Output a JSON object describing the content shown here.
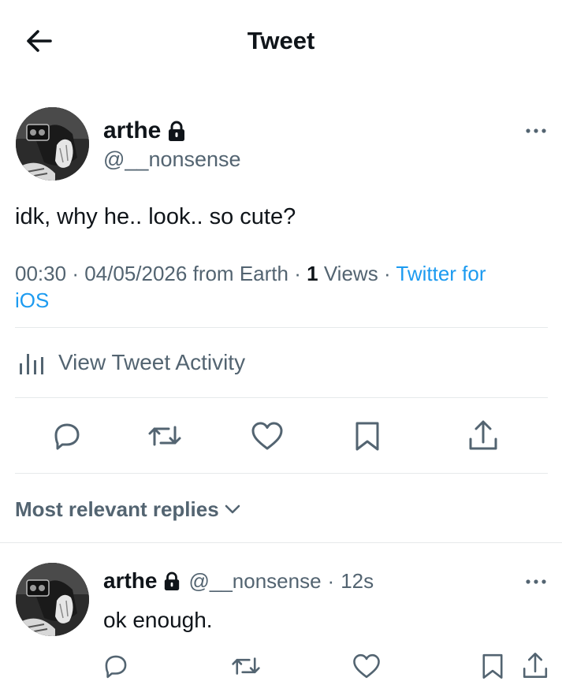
{
  "header": {
    "title": "Tweet",
    "back_icon": "back-arrow-icon"
  },
  "tweet": {
    "author": {
      "name": "arthe",
      "handle": "@__nonsense",
      "locked": true
    },
    "text": "idk, why he.. look.. so cute?",
    "meta": {
      "time": "00:30",
      "date": "04/05/2026",
      "from_text": "from Earth",
      "sep": "·",
      "views_count": "1",
      "views_label": "Views",
      "client_line1": "Twitter for",
      "client_line2": "iOS"
    },
    "activity_label": "View Tweet Activity",
    "actions": [
      "reply",
      "retweet",
      "like",
      "bookmark",
      "share"
    ]
  },
  "replies_sort": {
    "label": "Most relevant replies"
  },
  "reply": {
    "name": "arthe",
    "handle": "@__nonsense",
    "sep": "·",
    "age": "12s",
    "text": "ok enough."
  },
  "colors": {
    "link": "#1d9bf0",
    "muted": "#536471",
    "divider": "#e6e9eb",
    "text": "#0f1419"
  }
}
